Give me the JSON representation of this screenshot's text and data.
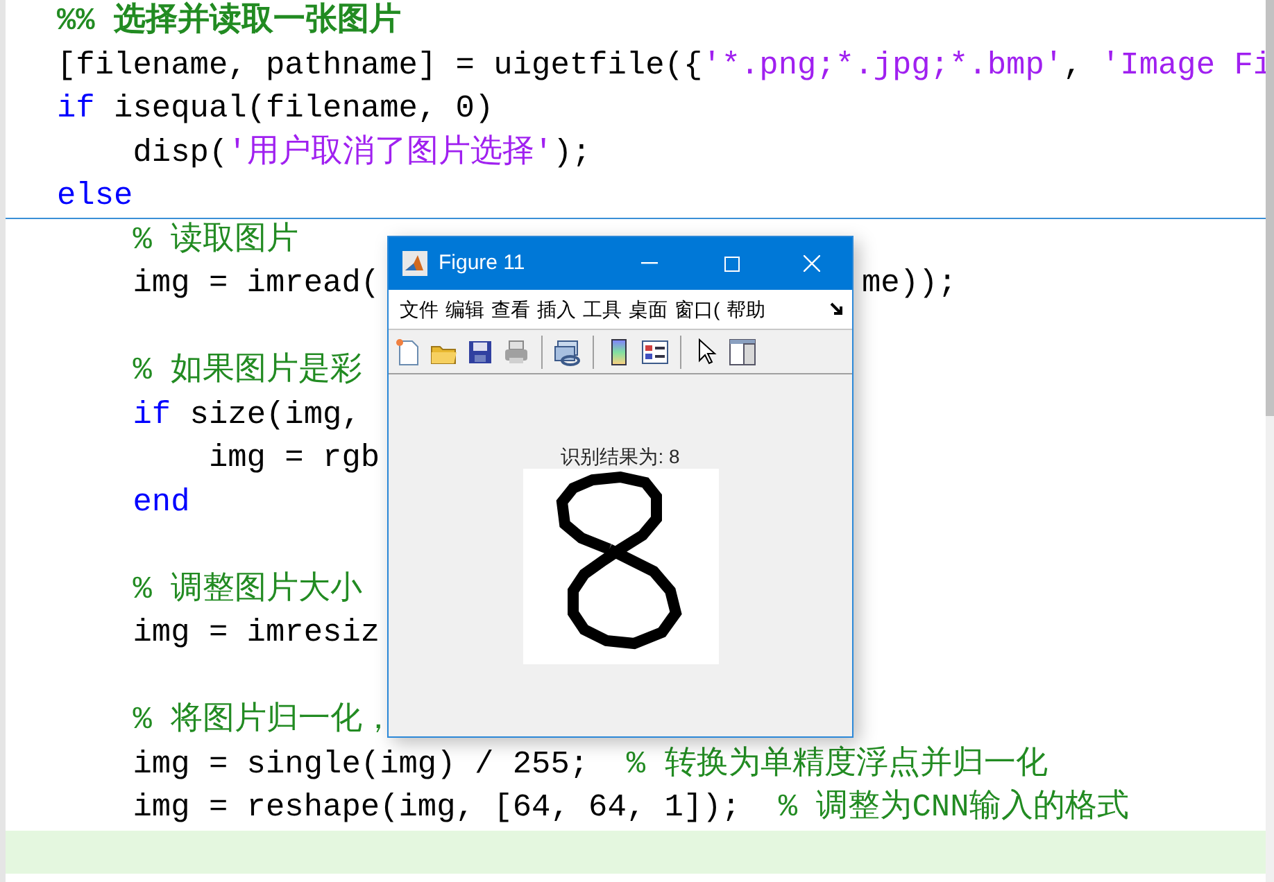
{
  "editor": {
    "lines": [
      {
        "tokens": [
          {
            "kind": "section",
            "text": "%% 选择并读取一张图片"
          }
        ]
      },
      {
        "tokens": [
          {
            "kind": "plain",
            "text": "[filename, pathname] = uigetfile({"
          },
          {
            "kind": "string",
            "text": "'*.png;*.jpg;*.bmp'"
          },
          {
            "kind": "plain",
            "text": ", "
          },
          {
            "kind": "string",
            "text": "'Image Fi"
          }
        ]
      },
      {
        "tokens": [
          {
            "kind": "keyword",
            "text": "if"
          },
          {
            "kind": "plain",
            "text": " isequal(filename, 0)"
          }
        ]
      },
      {
        "tokens": [
          {
            "kind": "plain",
            "text": "    disp("
          },
          {
            "kind": "string",
            "text": "'用户取消了图片选择'"
          },
          {
            "kind": "plain",
            "text": ");"
          }
        ]
      },
      {
        "tokens": [
          {
            "kind": "keyword",
            "text": "else"
          }
        ],
        "section_break": true
      },
      {
        "tokens": [
          {
            "kind": "comment",
            "text": "    % 读取图片"
          }
        ]
      },
      {
        "tokens": [
          {
            "kind": "plain",
            "text": "    img = imread("
          }
        ],
        "tail": [
          {
            "kind": "plain",
            "text": "me));"
          }
        ]
      },
      {
        "kind": "blank"
      },
      {
        "tokens": [
          {
            "kind": "comment",
            "text": "    % 如果图片是彩"
          }
        ]
      },
      {
        "tokens": [
          {
            "kind": "keyword",
            "text": "    if"
          },
          {
            "kind": "plain",
            "text": " size(img, "
          }
        ]
      },
      {
        "tokens": [
          {
            "kind": "plain",
            "text": "        img = rgb"
          }
        ]
      },
      {
        "tokens": [
          {
            "kind": "keyword",
            "text": "    end"
          }
        ]
      },
      {
        "kind": "blank"
      },
      {
        "tokens": [
          {
            "kind": "comment",
            "text": "    % 调整图片大小"
          }
        ]
      },
      {
        "tokens": [
          {
            "kind": "plain",
            "text": "    img = imresiz"
          }
        ]
      },
      {
        "kind": "blank"
      },
      {
        "tokens": [
          {
            "kind": "comment",
            "text": "    % 将图片归一化，"
          }
        ]
      },
      {
        "tokens": [
          {
            "kind": "plain",
            "text": "    img = single(img) / 255;  "
          },
          {
            "kind": "comment",
            "text": "% 转换为单精度浮点并归一化"
          }
        ]
      },
      {
        "tokens": [
          {
            "kind": "plain",
            "text": "    img = reshape(img, [64, 64, 1]);  "
          },
          {
            "kind": "comment",
            "text": "% 调整为CNN输入的格式"
          }
        ]
      },
      {
        "current": true
      }
    ]
  },
  "figure_window": {
    "title": "Figure 11",
    "menu": [
      "文件",
      "编辑",
      "查看",
      "插入",
      "工具",
      "桌面",
      "窗口(",
      "帮助"
    ],
    "toolbar": [
      {
        "kind": "new"
      },
      {
        "kind": "open"
      },
      {
        "kind": "save"
      },
      {
        "kind": "print"
      },
      {
        "kind": "sep"
      },
      {
        "kind": "link"
      },
      {
        "kind": "sep"
      },
      {
        "kind": "colorbar"
      },
      {
        "kind": "legend"
      },
      {
        "kind": "sep"
      },
      {
        "kind": "pointer"
      },
      {
        "kind": "panel"
      }
    ],
    "plot_title": "识别结果为: 8"
  }
}
